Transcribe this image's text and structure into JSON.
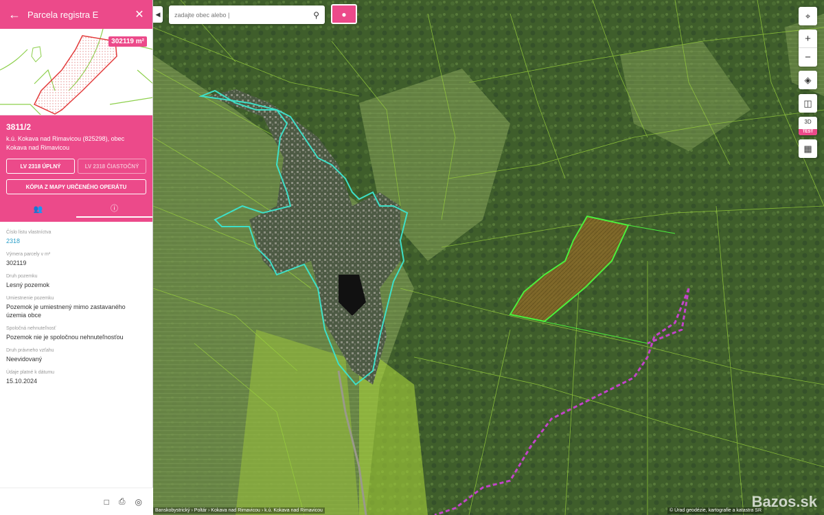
{
  "sidebar": {
    "header_title": "Parcela registra E",
    "area_badge": "302119 m²",
    "parcel_number": "3811/2",
    "location": "k.ú. Kokava nad Rimavicou (825298), obec Kokava nad Rimavicou",
    "btn_lv_full": "LV 2318 ÚPLNÝ",
    "btn_lv_partial": "LV 2318 ČIASTOČNÝ",
    "btn_copy_map": "KÓPIA Z MAPY URČENÉHO OPERÁTU",
    "fields": [
      {
        "label": "Číslo listu vlastníctva",
        "value": "2318"
      },
      {
        "label": "Výmera parcely v m²",
        "value": "302119"
      },
      {
        "label": "Druh pozemku",
        "value": "Lesný pozemok"
      },
      {
        "label": "Umiestnenie pozemku",
        "value": "Pozemok je umiestnený mimo zastavaného územia obce"
      },
      {
        "label": "Spoločná nehnuteľnosť",
        "value": "Pozemok nie je spoločnou nehnuteľnosťou"
      },
      {
        "label": "Druh právneho vzťahu",
        "value": "Neevidovaný"
      },
      {
        "label": "Údaje platné k dátumu",
        "value": "15.10.2024"
      }
    ]
  },
  "map": {
    "search_placeholder": "zadajte obec alebo |",
    "ctrl_3d": "3D",
    "ctrl_test": "TEST",
    "breadcrumb": "Banskobystrický › Poltár › Kokava nad Rimavicou › k.ú. Kokava nad Rimavicou",
    "attribution": "© Úrad geodézie, kartografie a katastra SR",
    "watermark": "Bazos.sk"
  },
  "colors": {
    "accent": "#ec4a8a",
    "link": "#2a9ec8"
  }
}
